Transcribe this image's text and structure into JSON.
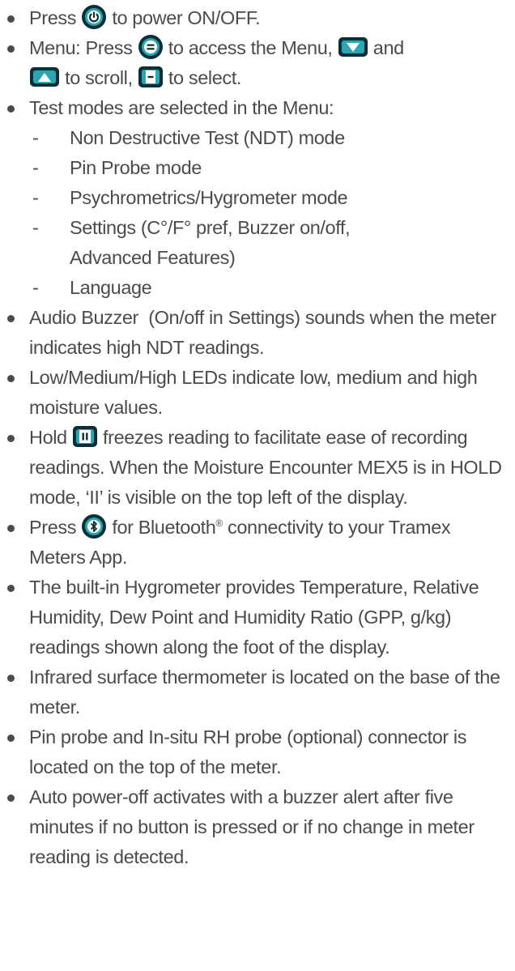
{
  "items": {
    "power": {
      "pre": "Press",
      "post": "to power ON/OFF."
    },
    "menu": {
      "a": "Menu: Press",
      "b": "to access the Menu,",
      "c": "and",
      "d": "to scroll,",
      "e": "to select."
    },
    "test_modes": {
      "text": "Test modes are selected in the Menu:",
      "subs": [
        "Non Destructive Test (NDT) mode",
        "Pin Probe mode",
        "Psychrometrics/Hygrometer mode",
        "Settings (C°/F° pref, Buzzer on/off, Advanced Features)",
        "Language"
      ]
    },
    "buzzer": "Audio Buzzer  (On/off in Settings) sounds when the meter indicates high NDT readings.",
    "leds": "Low/Medium/High LEDs indicate low, medium and high moisture values.",
    "hold": {
      "pre": "Hold",
      "post": "freezes reading to facilitate ease of recording readings. When the Moisture Encounter MEX5 is in HOLD mode, ‘II’ is visible on the top left of the display."
    },
    "bluetooth": {
      "pre": "Press",
      "mid": "for Bluetooth",
      "reg": "®",
      "post": " connectivity to your Tramex Meters App."
    },
    "hygrometer": "The built-in Hygrometer provides Temperature, Relative Humidity, Dew Point and Humidity Ratio (GPP, g/kg) readings shown along the foot of the display.",
    "infrared": "Infrared surface thermometer is located on the base of the meter.",
    "probe": "Pin probe and In-situ RH probe (optional) connector is located on the top of the meter.",
    "autooff": "Auto power-off activates with a buzzer alert after five minutes if no button is pressed or if no change in meter reading is detected."
  },
  "icons": {
    "power": "power-icon",
    "menu": "menu-icon",
    "down": "down-arrow-icon",
    "up": "up-arrow-icon",
    "select": "select-icon",
    "hold": "hold-icon",
    "bluetooth": "bluetooth-icon"
  },
  "colors": {
    "icon_dark": "#0a2f36",
    "icon_accent": "#2aa7b4",
    "text": "#4b4b4b"
  }
}
